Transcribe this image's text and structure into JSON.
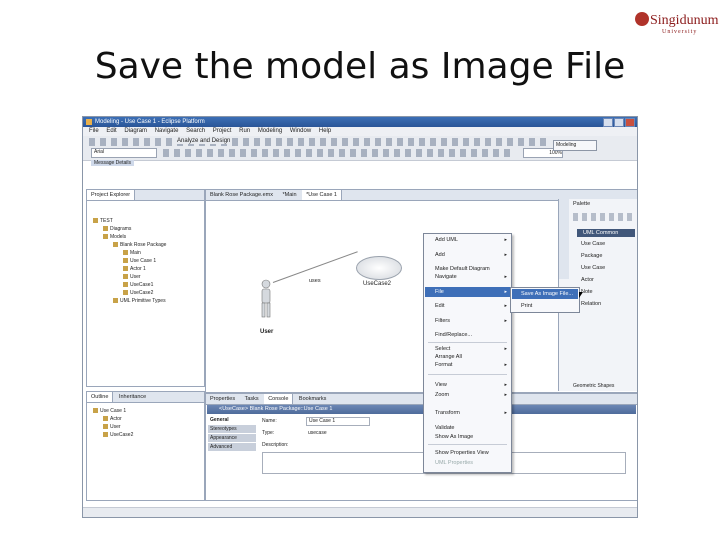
{
  "slide": {
    "title": "Save the model as Image File"
  },
  "logo": {
    "name": "Singidunum",
    "sub": "University"
  },
  "window": {
    "title": "Modeling - Use Case 1 - Eclipse Platform"
  },
  "menubar": [
    "File",
    "Edit",
    "Diagram",
    "Navigate",
    "Search",
    "Project",
    "Run",
    "Modeling",
    "Window",
    "Help"
  ],
  "toolbar": {
    "analyze": "Analyze and Design",
    "font_combo": "Arial",
    "zoom": "100%",
    "perspective": "Modeling",
    "message_tab": "Message Details"
  },
  "project_explorer": {
    "tab": "Project Explorer",
    "items": [
      "TEST",
      "Diagrams",
      "Models",
      "Blank Rose Package",
      "Main",
      "Use Case 1",
      "Actor 1",
      "User",
      "UseCase1",
      "UseCase2",
      "UML Primitive Types"
    ]
  },
  "editor_tabs": [
    "Blank Rose Package.emx",
    "*Main",
    "*Use Case 1"
  ],
  "diagram": {
    "actor_label": "User",
    "usecase_label": "UseCase2",
    "assoc_label": "uses"
  },
  "context_menu": {
    "items": [
      "Add UML",
      "Add",
      "Make Default Diagram",
      "Navigate",
      "File",
      "Edit",
      "Filters",
      "Find/Replace...",
      "Select",
      "Arrange All",
      "Format",
      "View",
      "Zoom",
      "Transform",
      "Validate",
      "Show As Image",
      "Show Properties View",
      "UML Properties"
    ],
    "highlighted": "File"
  },
  "submenu": {
    "items": [
      "Save As Image File...",
      "Print"
    ]
  },
  "palette": {
    "title": "Palette",
    "section": "UML Common",
    "items": [
      "Use Case",
      "Package",
      "Use Case",
      "Actor",
      "Note",
      "Relation"
    ],
    "footer": "Geometric Shapes"
  },
  "outline": {
    "tabs": [
      "Outline",
      "Inheritance"
    ],
    "items": [
      "Use Case 1",
      "Actor",
      "User",
      "UseCase2"
    ]
  },
  "properties": {
    "tabs": [
      "Properties",
      "Tasks",
      "Console",
      "Bookmarks"
    ],
    "header": "<UseCase> Blank Rose Package::Use Case 1",
    "side": [
      "General",
      "Stereotypes",
      "Appearance",
      "Advanced"
    ],
    "fields": [
      {
        "label": "Name:",
        "value": "Use Case 1"
      },
      {
        "label": "Type:",
        "value": "usecase"
      },
      {
        "label": "Description:",
        "value": ""
      }
    ]
  }
}
